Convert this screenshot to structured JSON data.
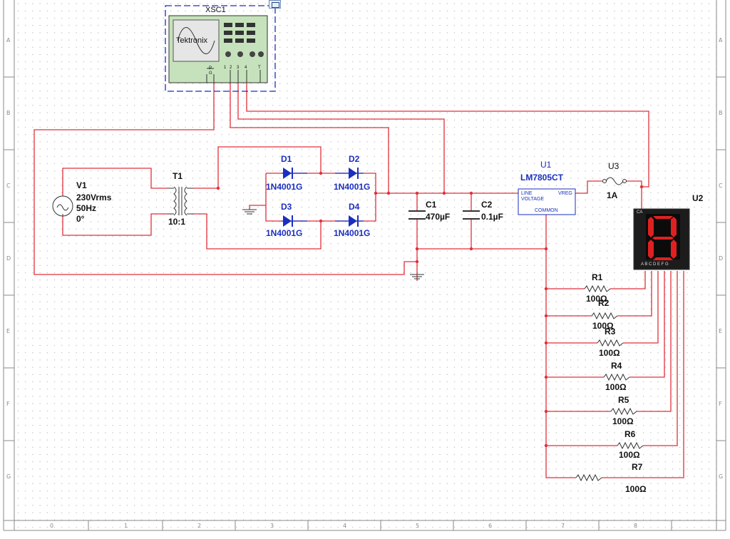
{
  "toolbar_icon": "window-icon",
  "ruler": {
    "rows": [
      "A",
      "B",
      "C",
      "D",
      "E",
      "F",
      "G"
    ],
    "cols": [
      "0",
      "1",
      "2",
      "3",
      "4",
      "5",
      "6",
      "7",
      "8"
    ]
  },
  "components": {
    "oscilloscope": {
      "ref": "XSC1",
      "brand": "Tektronix",
      "pins": [
        "P",
        "G",
        "1",
        "2",
        "3",
        "4",
        "T"
      ]
    },
    "source": {
      "ref": "V1",
      "voltage": "230Vrms",
      "freq": "50Hz",
      "phase": "0°"
    },
    "transformer": {
      "ref": "T1",
      "ratio": "10:1"
    },
    "diodes": [
      {
        "ref": "D1",
        "model": "1N4001G"
      },
      {
        "ref": "D2",
        "model": "1N4001G"
      },
      {
        "ref": "D3",
        "model": "1N4001G"
      },
      {
        "ref": "D4",
        "model": "1N4001G"
      }
    ],
    "c1": {
      "ref": "C1",
      "value": "470µF"
    },
    "c2": {
      "ref": "C2",
      "value": "0.1µF"
    },
    "regulator": {
      "ref": "U1",
      "model": "LM7805CT",
      "pin_line": "LINE",
      "pin_vreg": "VREG",
      "pin_voltage": "VOLTAGE",
      "pin_common": "COMMON"
    },
    "fuse": {
      "ref": "U3",
      "value": "1A"
    },
    "display": {
      "ref": "U2",
      "pin_ca": "CA",
      "pins": "A B C D E F G",
      "digit_color": "#e02020"
    },
    "resistors": [
      {
        "ref": "R1",
        "value": "100Ω"
      },
      {
        "ref": "R2",
        "value": "100Ω"
      },
      {
        "ref": "R3",
        "value": "100Ω"
      },
      {
        "ref": "R4",
        "value": "100Ω"
      },
      {
        "ref": "R5",
        "value": "100Ω"
      },
      {
        "ref": "R6",
        "value": "100Ω"
      },
      {
        "ref": "R7",
        "value": "100Ω"
      }
    ]
  },
  "colors": {
    "wire": "#e0303a",
    "component": "#1a2fbf",
    "scope_bg": "#c6e2bc",
    "scope_frame": "#1a2fbf",
    "grid_dot": "#9a9a9a"
  }
}
